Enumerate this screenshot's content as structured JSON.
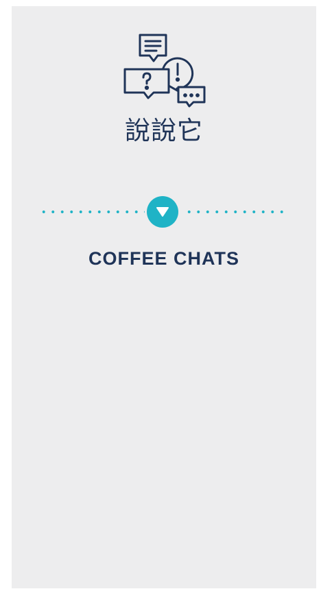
{
  "page": {
    "title": "說說它",
    "section_title": "COFFEE CHATS",
    "icon": "chat-bubbles-icon",
    "toggle_icon": "caret-down-icon"
  },
  "colors": {
    "panel_background": "#ededee",
    "text": "#1f3458",
    "accent": "#1fb3c6"
  }
}
